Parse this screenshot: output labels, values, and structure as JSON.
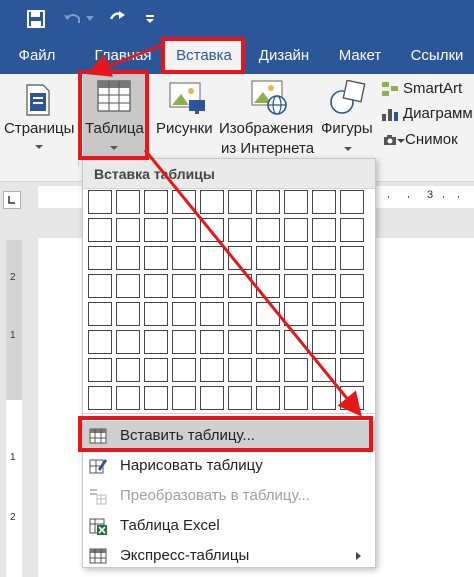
{
  "tabs": [
    {
      "label": "Файл"
    },
    {
      "label": "Главная"
    },
    {
      "label": "Вставка"
    },
    {
      "label": "Дизайн"
    },
    {
      "label": "Макет"
    },
    {
      "label": "Ссылки"
    }
  ],
  "ribbon": {
    "pages_label": "Страницы",
    "table_label": "Таблица",
    "pictures_label": "Рисунки",
    "online_label_1": "Изображения",
    "online_label_2": "из Интернета",
    "shapes_label": "Фигуры",
    "smartart_label": "SmartArt",
    "chart_label": "Диаграмм",
    "screenshot_label": "Снимок"
  },
  "ruler": {
    "h_mark": "3",
    "v_marks": [
      "2",
      "1",
      "1",
      "2"
    ]
  },
  "dropdown": {
    "title": "Вставка таблицы",
    "items": [
      {
        "label": "Вставить таблицу..."
      },
      {
        "label": "Нарисовать таблицу"
      },
      {
        "label": "Преобразовать в таблицу..."
      },
      {
        "label": "Таблица Excel"
      },
      {
        "label": "Экспресс-таблицы"
      }
    ]
  },
  "colors": {
    "accent": "#2b579a",
    "highlight_red": "#e8161b",
    "excel_green": "#217346"
  }
}
